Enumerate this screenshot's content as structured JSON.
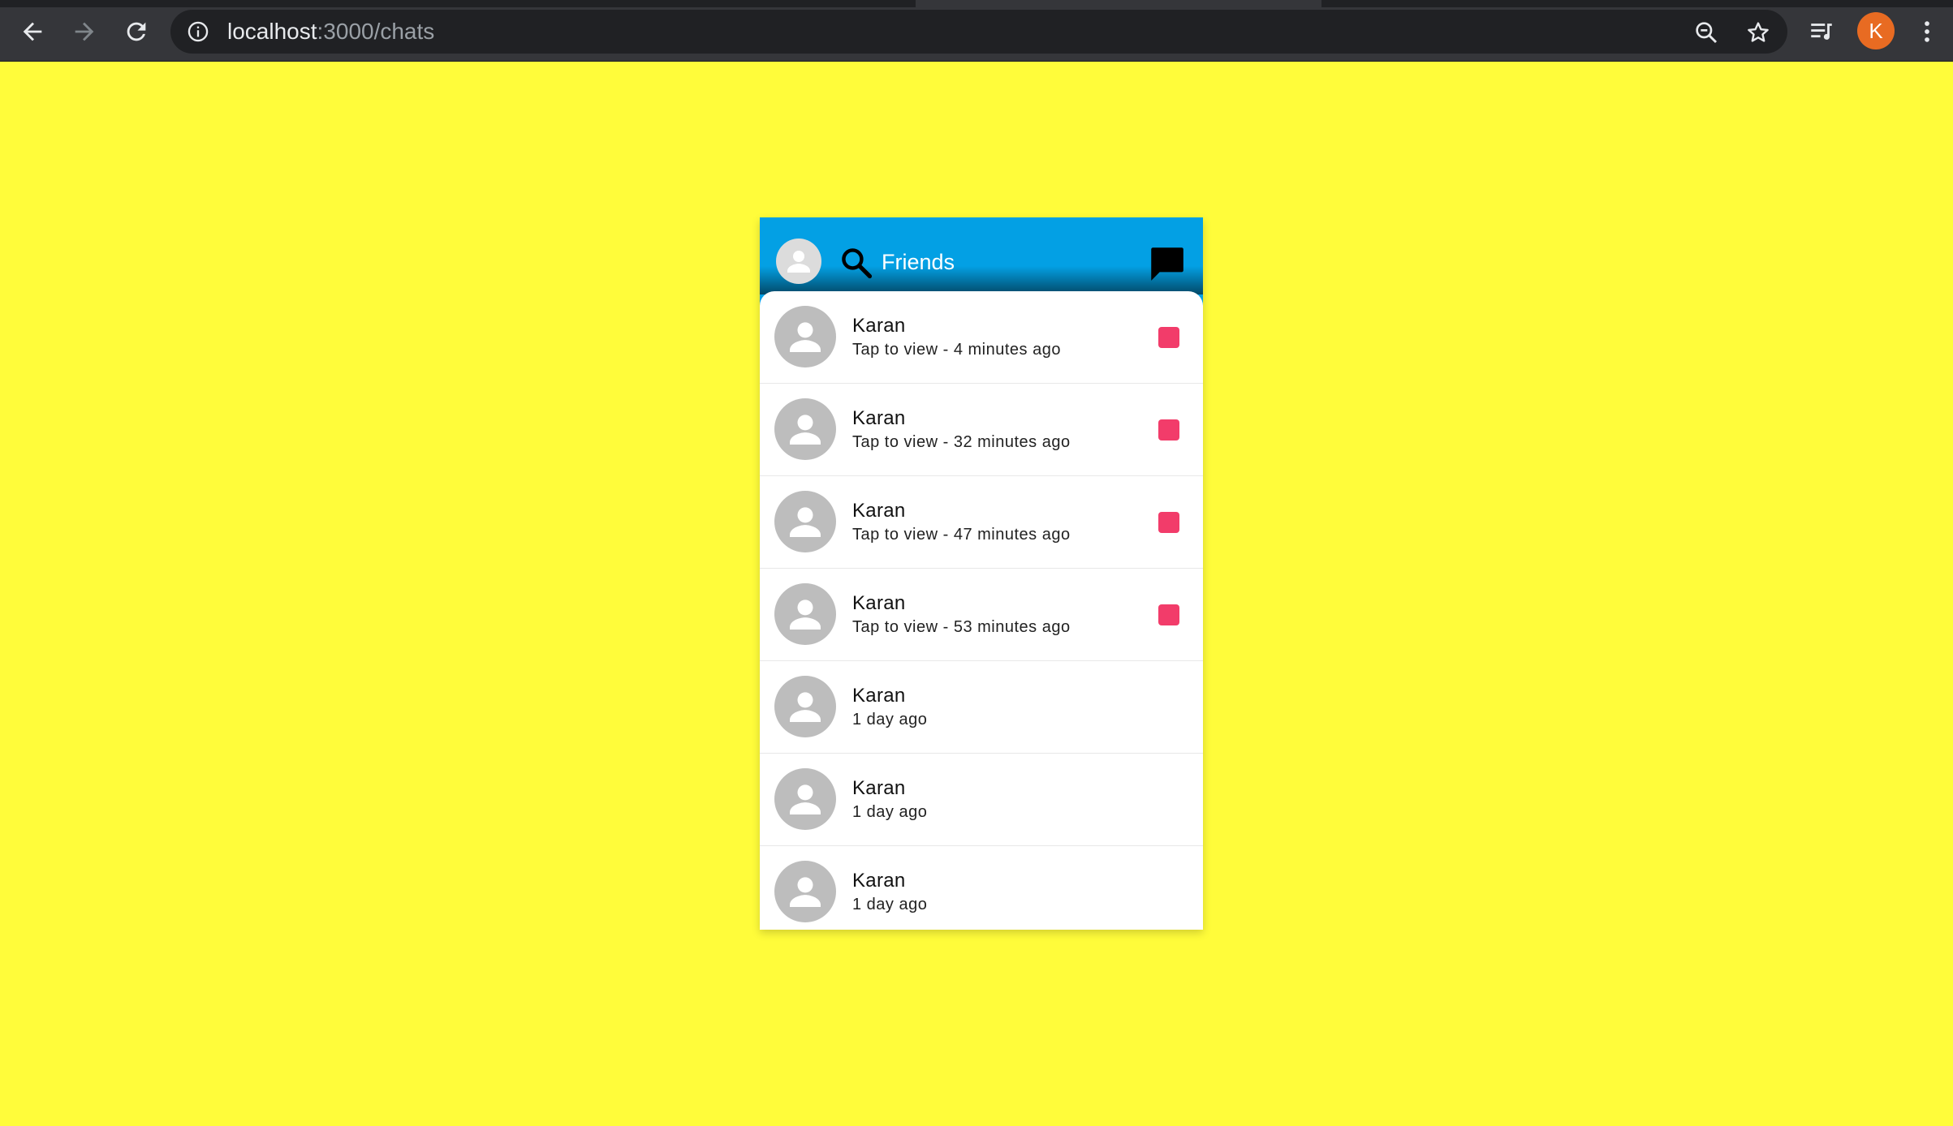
{
  "browser": {
    "url_host": "localhost",
    "url_path": ":3000/chats",
    "profile_initial": "K"
  },
  "app": {
    "header": {
      "title": "Friends"
    },
    "colors": {
      "background": "#fffc3a",
      "header": "#03a0e4",
      "unread_badge": "#f23c6a"
    },
    "chats": [
      {
        "name": "Karan",
        "status": "Tap to view - 4 minutes ago",
        "unread": true
      },
      {
        "name": "Karan",
        "status": "Tap to view - 32 minutes ago",
        "unread": true
      },
      {
        "name": "Karan",
        "status": "Tap to view - 47 minutes ago",
        "unread": true
      },
      {
        "name": "Karan",
        "status": "Tap to view - 53 minutes ago",
        "unread": true
      },
      {
        "name": "Karan",
        "status": "1 day ago",
        "unread": false
      },
      {
        "name": "Karan",
        "status": "1 day ago",
        "unread": false
      },
      {
        "name": "Karan",
        "status": "1 day ago",
        "unread": false
      }
    ]
  }
}
